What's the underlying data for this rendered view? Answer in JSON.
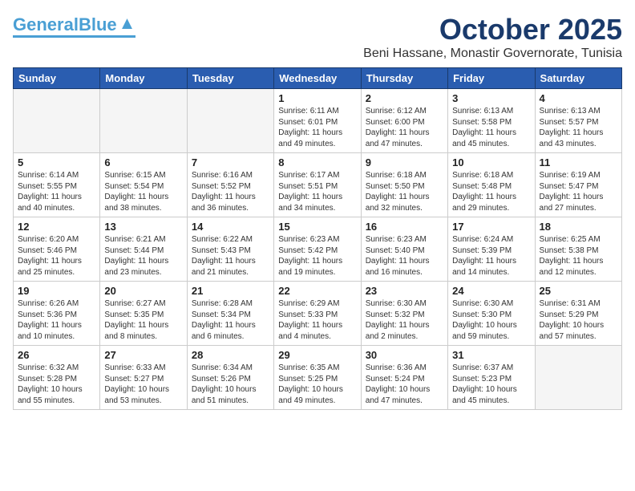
{
  "logo": {
    "part1": "General",
    "part2": "Blue"
  },
  "title": "October 2025",
  "location": "Beni Hassane, Monastir Governorate, Tunisia",
  "weekdays": [
    "Sunday",
    "Monday",
    "Tuesday",
    "Wednesday",
    "Thursday",
    "Friday",
    "Saturday"
  ],
  "weeks": [
    [
      {
        "day": "",
        "text": ""
      },
      {
        "day": "",
        "text": ""
      },
      {
        "day": "",
        "text": ""
      },
      {
        "day": "1",
        "text": "Sunrise: 6:11 AM\nSunset: 6:01 PM\nDaylight: 11 hours\nand 49 minutes."
      },
      {
        "day": "2",
        "text": "Sunrise: 6:12 AM\nSunset: 6:00 PM\nDaylight: 11 hours\nand 47 minutes."
      },
      {
        "day": "3",
        "text": "Sunrise: 6:13 AM\nSunset: 5:58 PM\nDaylight: 11 hours\nand 45 minutes."
      },
      {
        "day": "4",
        "text": "Sunrise: 6:13 AM\nSunset: 5:57 PM\nDaylight: 11 hours\nand 43 minutes."
      }
    ],
    [
      {
        "day": "5",
        "text": "Sunrise: 6:14 AM\nSunset: 5:55 PM\nDaylight: 11 hours\nand 40 minutes."
      },
      {
        "day": "6",
        "text": "Sunrise: 6:15 AM\nSunset: 5:54 PM\nDaylight: 11 hours\nand 38 minutes."
      },
      {
        "day": "7",
        "text": "Sunrise: 6:16 AM\nSunset: 5:52 PM\nDaylight: 11 hours\nand 36 minutes."
      },
      {
        "day": "8",
        "text": "Sunrise: 6:17 AM\nSunset: 5:51 PM\nDaylight: 11 hours\nand 34 minutes."
      },
      {
        "day": "9",
        "text": "Sunrise: 6:18 AM\nSunset: 5:50 PM\nDaylight: 11 hours\nand 32 minutes."
      },
      {
        "day": "10",
        "text": "Sunrise: 6:18 AM\nSunset: 5:48 PM\nDaylight: 11 hours\nand 29 minutes."
      },
      {
        "day": "11",
        "text": "Sunrise: 6:19 AM\nSunset: 5:47 PM\nDaylight: 11 hours\nand 27 minutes."
      }
    ],
    [
      {
        "day": "12",
        "text": "Sunrise: 6:20 AM\nSunset: 5:46 PM\nDaylight: 11 hours\nand 25 minutes."
      },
      {
        "day": "13",
        "text": "Sunrise: 6:21 AM\nSunset: 5:44 PM\nDaylight: 11 hours\nand 23 minutes."
      },
      {
        "day": "14",
        "text": "Sunrise: 6:22 AM\nSunset: 5:43 PM\nDaylight: 11 hours\nand 21 minutes."
      },
      {
        "day": "15",
        "text": "Sunrise: 6:23 AM\nSunset: 5:42 PM\nDaylight: 11 hours\nand 19 minutes."
      },
      {
        "day": "16",
        "text": "Sunrise: 6:23 AM\nSunset: 5:40 PM\nDaylight: 11 hours\nand 16 minutes."
      },
      {
        "day": "17",
        "text": "Sunrise: 6:24 AM\nSunset: 5:39 PM\nDaylight: 11 hours\nand 14 minutes."
      },
      {
        "day": "18",
        "text": "Sunrise: 6:25 AM\nSunset: 5:38 PM\nDaylight: 11 hours\nand 12 minutes."
      }
    ],
    [
      {
        "day": "19",
        "text": "Sunrise: 6:26 AM\nSunset: 5:36 PM\nDaylight: 11 hours\nand 10 minutes."
      },
      {
        "day": "20",
        "text": "Sunrise: 6:27 AM\nSunset: 5:35 PM\nDaylight: 11 hours\nand 8 minutes."
      },
      {
        "day": "21",
        "text": "Sunrise: 6:28 AM\nSunset: 5:34 PM\nDaylight: 11 hours\nand 6 minutes."
      },
      {
        "day": "22",
        "text": "Sunrise: 6:29 AM\nSunset: 5:33 PM\nDaylight: 11 hours\nand 4 minutes."
      },
      {
        "day": "23",
        "text": "Sunrise: 6:30 AM\nSunset: 5:32 PM\nDaylight: 11 hours\nand 2 minutes."
      },
      {
        "day": "24",
        "text": "Sunrise: 6:30 AM\nSunset: 5:30 PM\nDaylight: 10 hours\nand 59 minutes."
      },
      {
        "day": "25",
        "text": "Sunrise: 6:31 AM\nSunset: 5:29 PM\nDaylight: 10 hours\nand 57 minutes."
      }
    ],
    [
      {
        "day": "26",
        "text": "Sunrise: 6:32 AM\nSunset: 5:28 PM\nDaylight: 10 hours\nand 55 minutes."
      },
      {
        "day": "27",
        "text": "Sunrise: 6:33 AM\nSunset: 5:27 PM\nDaylight: 10 hours\nand 53 minutes."
      },
      {
        "day": "28",
        "text": "Sunrise: 6:34 AM\nSunset: 5:26 PM\nDaylight: 10 hours\nand 51 minutes."
      },
      {
        "day": "29",
        "text": "Sunrise: 6:35 AM\nSunset: 5:25 PM\nDaylight: 10 hours\nand 49 minutes."
      },
      {
        "day": "30",
        "text": "Sunrise: 6:36 AM\nSunset: 5:24 PM\nDaylight: 10 hours\nand 47 minutes."
      },
      {
        "day": "31",
        "text": "Sunrise: 6:37 AM\nSunset: 5:23 PM\nDaylight: 10 hours\nand 45 minutes."
      },
      {
        "day": "",
        "text": ""
      }
    ]
  ]
}
